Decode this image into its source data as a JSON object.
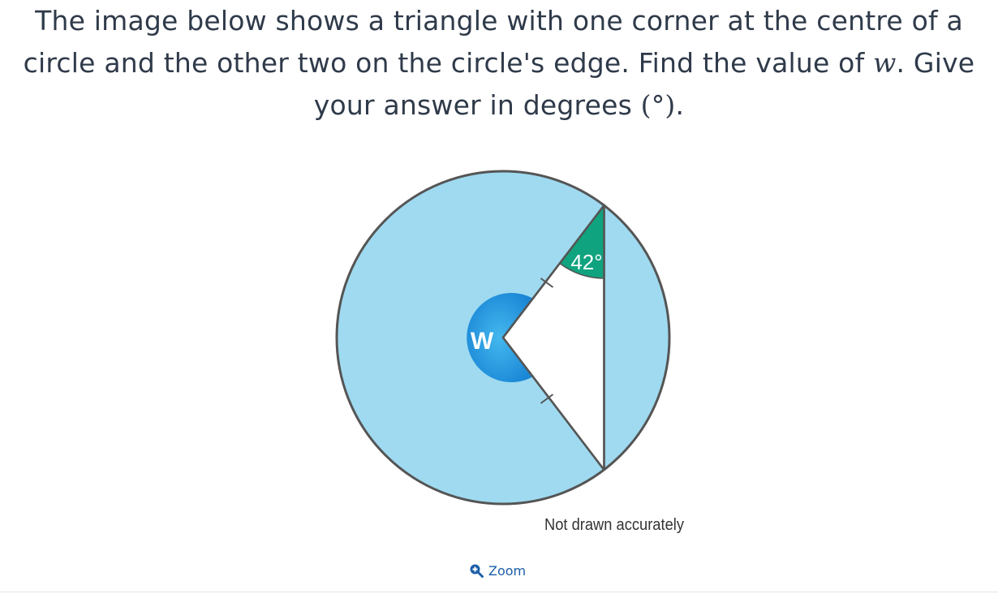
{
  "question": {
    "text_before_var": "The image below shows a triangle with one corner at the centre of a circle and the other two on the circle's edge. Find the value of ",
    "variable": "w",
    "text_after_var": ". Give your answer in degrees ",
    "unit": "(°)",
    "end": "."
  },
  "diagram": {
    "center_label": "W",
    "angle_label": "42°",
    "note": "Not drawn accurately",
    "colors": {
      "circle_fill": "#9fdaf0",
      "circle_stroke": "#555555",
      "triangle_fill": "#ffffff",
      "angle_w_fill": "#1e8fdb",
      "angle_w_fill_light": "#35aee8",
      "angle_42_fill": "#10a37f"
    }
  },
  "controls": {
    "zoom_label": "Zoom",
    "zoom_icon": "zoom-in-icon"
  }
}
